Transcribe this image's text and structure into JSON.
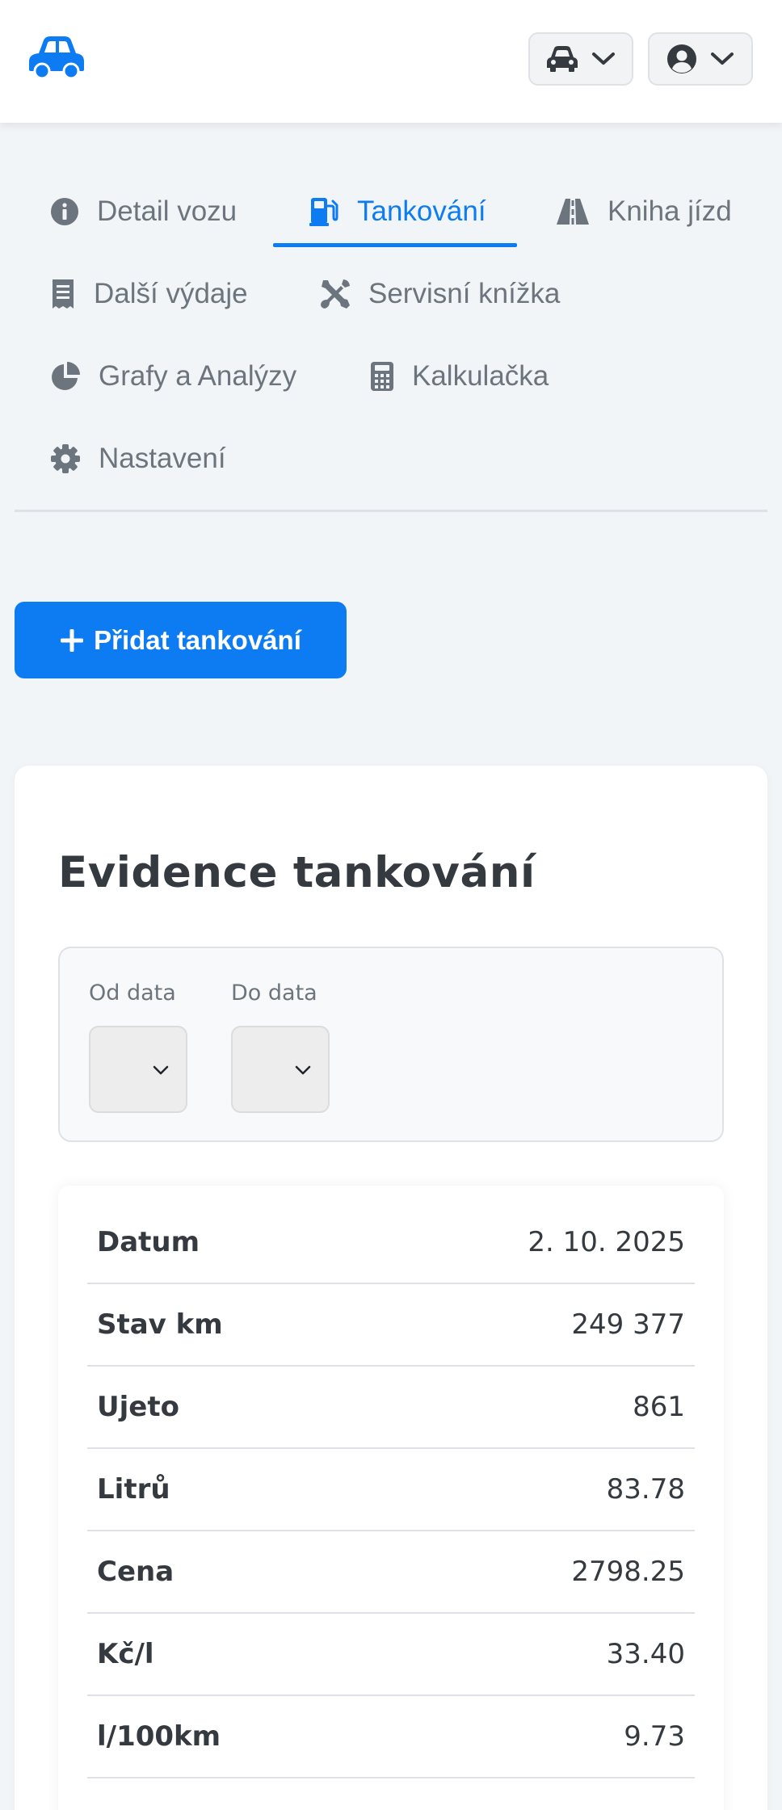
{
  "header": {
    "logo_icon": "car-icon",
    "car_menu_icon": "car-icon",
    "user_menu_icon": "user-circle-icon",
    "accent": "#0d7cf2"
  },
  "tabs": [
    {
      "label": "Detail vozu",
      "icon": "info-circle-icon",
      "active": false
    },
    {
      "label": "Tankování",
      "icon": "gas-pump-icon",
      "active": true
    },
    {
      "label": "Kniha jízd",
      "icon": "road-icon",
      "active": false
    },
    {
      "label": "Další výdaje",
      "icon": "receipt-icon",
      "active": false
    },
    {
      "label": "Servisní knížka",
      "icon": "tools-icon",
      "active": false
    },
    {
      "label": "Grafy a Analýzy",
      "icon": "pie-chart-icon",
      "active": false
    },
    {
      "label": "Kalkulačka",
      "icon": "calculator-icon",
      "active": false
    },
    {
      "label": "Nastavení",
      "icon": "gear-icon",
      "active": false
    }
  ],
  "actions": {
    "add_label": "Přidat tankování"
  },
  "records": {
    "title": "Evidence tankování",
    "filter": {
      "from_label": "Od data",
      "to_label": "Do data",
      "from_value": "",
      "to_value": ""
    },
    "rows": [
      {
        "label": "Datum",
        "value": "2. 10. 2025"
      },
      {
        "label": "Stav km",
        "value": "249 377"
      },
      {
        "label": "Ujeto",
        "value": "861"
      },
      {
        "label": "Litrů",
        "value": "83.78"
      },
      {
        "label": "Cena",
        "value": "2798.25"
      },
      {
        "label": "Kč/l",
        "value": "33.40"
      },
      {
        "label": "l/100km",
        "value": "9.73"
      }
    ]
  }
}
